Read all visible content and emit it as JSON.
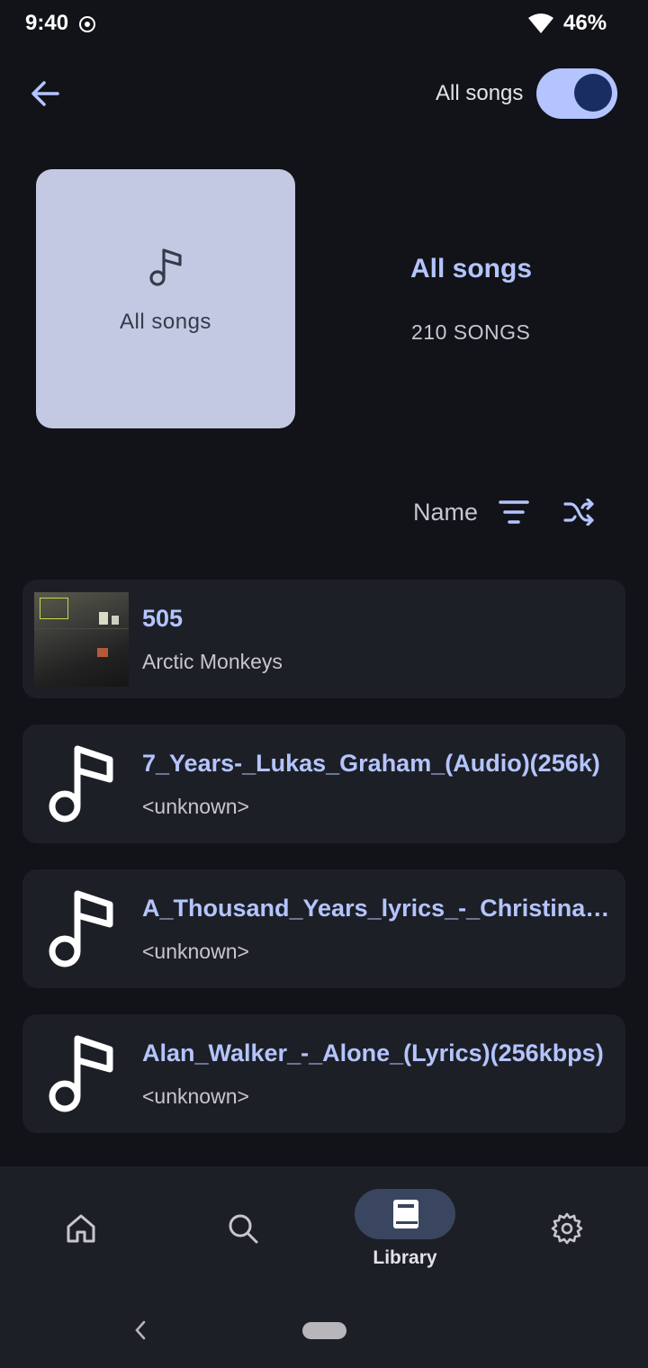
{
  "status_bar": {
    "time": "9:40",
    "battery": "46%"
  },
  "header": {
    "toggle_label": "All songs"
  },
  "playlist": {
    "cover_label": "All songs",
    "title": "All songs",
    "count": "210 SONGS"
  },
  "sort": {
    "label": "Name"
  },
  "songs": [
    {
      "title": "505",
      "artist": "Arctic Monkeys"
    },
    {
      "title": "7_Years-_Lukas_Graham_(Audio)(256k)",
      "artist": "<unknown>"
    },
    {
      "title": "A_Thousand_Years_lyrics_-_Christina_Perri",
      "artist": "<unknown>"
    },
    {
      "title": "Alan_Walker_-_Alone_(Lyrics)(256kbps)",
      "artist": "<unknown>"
    }
  ],
  "nav": {
    "library_label": "Library"
  },
  "colors": {
    "accent": "#b4c4ff",
    "background": "#121318",
    "card": "#1d1f26"
  }
}
